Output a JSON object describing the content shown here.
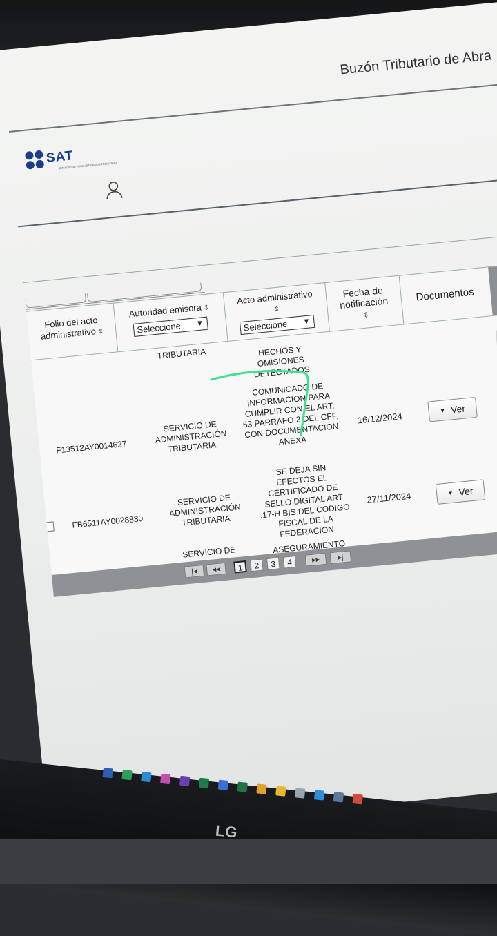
{
  "header": {
    "portal_title": "Buzón Tributario de  Abra",
    "logo_text": "SAT",
    "logo_subtitle": "SERVICIO DE ADMINISTRACIÓN TRIBUTARIA"
  },
  "table": {
    "columns": {
      "folio": "Folio del acto administrativo",
      "autoridad": "Autoridad emisora",
      "acto": "Acto administrativo",
      "fecha": "Fecha de notificación",
      "documentos": "Documentos"
    },
    "filters": {
      "autoridad_select": "Seleccione",
      "acto_select": "Seleccione"
    },
    "partial_top": {
      "autoridad": "TRIBUTARIA",
      "acto": "HECHOS Y OMISIONES DETECTADOS"
    },
    "rows": [
      {
        "folio": "F13512AY0014627",
        "autoridad": "SERVICIO DE ADMINISTRACIÓN TRIBUTARIA",
        "acto": "COMUNICADO DE INFORMACION PARA CUMPLIR CON EL ART. 63 PARRAFO 2 DEL CFF, CON DOCUMENTACION ANEXA",
        "fecha": "16/12/2024",
        "ver": "Ver"
      },
      {
        "folio": "FB6511AY0028880",
        "autoridad": "SERVICIO DE ADMINISTRACIÓN TRIBUTARIA",
        "acto": "SE DEJA SIN EFECTOS EL CERTIFICADO DE SELLO DIGITAL ART .17-H BIS DEL CODIGO FISCAL DE LA FEDERACION",
        "fecha": "27/11/2024",
        "ver": "Ver"
      }
    ],
    "partial_bottom": {
      "autoridad": "SERVICIO DE",
      "acto": "ASEGURAMIENTO"
    }
  },
  "pager": {
    "first": "|◂",
    "prev": "◂◂",
    "pages": [
      "1",
      "2",
      "3",
      "4"
    ],
    "current_page": "1",
    "next": "▸▸",
    "last": "▸|"
  },
  "monitor": {
    "brand": "LG"
  },
  "colors": {
    "annotation": "#3fe08f",
    "sat_blue": "#1c3c8c",
    "pager_bg": "#8e9195"
  }
}
